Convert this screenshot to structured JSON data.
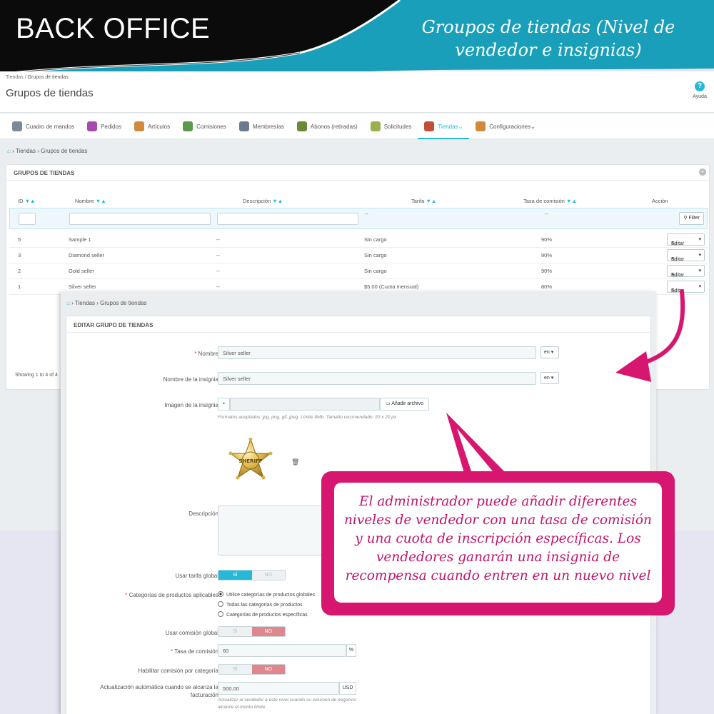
{
  "banner": {
    "title": "BACK OFFICE",
    "subtitle": "Groupos de tiendas (Nivel de vendedor e insignias)"
  },
  "page": {
    "crumb_parent": "Tiendas",
    "crumb_current": "Grupos de tiendas",
    "title": "Grupos de tiendas",
    "help_label": "Ayuda"
  },
  "nav": [
    {
      "label": "Cuadro de mandos",
      "icon": "dashboard-icon",
      "color": "#7a8a99"
    },
    {
      "label": "Pedidos",
      "icon": "cart-icon",
      "color": "#a54bb0"
    },
    {
      "label": "Artículos",
      "icon": "boxes-icon",
      "color": "#d08a3a"
    },
    {
      "label": "Comisiones",
      "icon": "money-bag-icon",
      "color": "#5a9a4a"
    },
    {
      "label": "Membresías",
      "icon": "membership-icon",
      "color": "#6b7a8c"
    },
    {
      "label": "Abonos (retiradas)",
      "icon": "house-money-icon",
      "color": "#6a8a3a"
    },
    {
      "label": "Solicitudes",
      "icon": "request-icon",
      "color": "#9ab04a"
    },
    {
      "label": "Tiendas",
      "icon": "store-icon",
      "color": "#c0503a",
      "active": true
    },
    {
      "label": "Configuraciones",
      "icon": "gears-icon",
      "color": "#d08a3a"
    }
  ],
  "breadcrumb": {
    "section": "Tiendas",
    "current": "Grupos de tiendas"
  },
  "list": {
    "heading": "GRUPOS DE TIENDAS",
    "columns": {
      "id": "ID",
      "name": "Nombre",
      "description": "Descripción",
      "fee": "Tarifa",
      "commission": "Tasa de comisión",
      "action": "Acción"
    },
    "filter_placeholder_fee": "--",
    "filter_placeholder_commission": "--",
    "filter_button": "Filter",
    "edit_label": "Editar",
    "rows": [
      {
        "id": "5",
        "name": "Sample 1",
        "description": "--",
        "fee": "Sin cargo",
        "commission": "90%"
      },
      {
        "id": "3",
        "name": "Diamond seller",
        "description": "--",
        "fee": "Sin cargo",
        "commission": "90%"
      },
      {
        "id": "2",
        "name": "Gold seller",
        "description": "--",
        "fee": "Sin cargo",
        "commission": "90%"
      },
      {
        "id": "1",
        "name": "Silver seller",
        "description": "--",
        "fee": "$5.00 (Cuota mensual)",
        "commission": "80%"
      }
    ],
    "showing": "Showing 1 to 4 of 4"
  },
  "form": {
    "crumb_section": "Tiendas",
    "crumb_current": "Grupos de tiendas",
    "heading": "EDITAR GRUPO DE TIENDAS",
    "name_label": "Nombre",
    "name_value": "Silver seller",
    "badge_name_label": "Nombre de la insignia",
    "badge_name_value": "Silver seller",
    "lang": "en",
    "badge_image_label": "Imagen de la insignia",
    "add_file_button": "Añadir archivo",
    "file_hint": "Formatos aceptados: jpg, png, gif, jpeg. Límite 8Mb. Tamaño recomendado: 20 x 20 px",
    "badge_text": "SHERIFF",
    "description_label": "Descripción",
    "global_fee_label": "Usar tarifa global",
    "yes": "SÍ",
    "no": "NO",
    "categories_label": "Categorías de productos aplicables",
    "category_options": [
      "Utilice categorías de productos globales",
      "Todas las categorías de productos",
      "Categorías de productos específicas"
    ],
    "global_commission_label": "Usar comisión global",
    "commission_rate_label": "Tasa de comisión",
    "commission_rate_value": "60",
    "commission_unit": "%",
    "category_commission_label": "Habilitar comisión por categoría",
    "auto_update_label": "Actualización automática cuando se alcanza la facturación",
    "auto_update_value": "500.00",
    "auto_update_currency": "USD",
    "auto_update_hint": "Actualizar al vendedor a este nivel cuando su volumen de negocios alcance el monto límite"
  },
  "callout": {
    "text": "El administrador puede añadir diferentes niveles de vendedor con una tasa de comisión y una cuota de inscripción específicas. Los vendedores ganarán una insignia de recompensa cuando entren en un nuevo nivel",
    "color": "#d6166f"
  }
}
